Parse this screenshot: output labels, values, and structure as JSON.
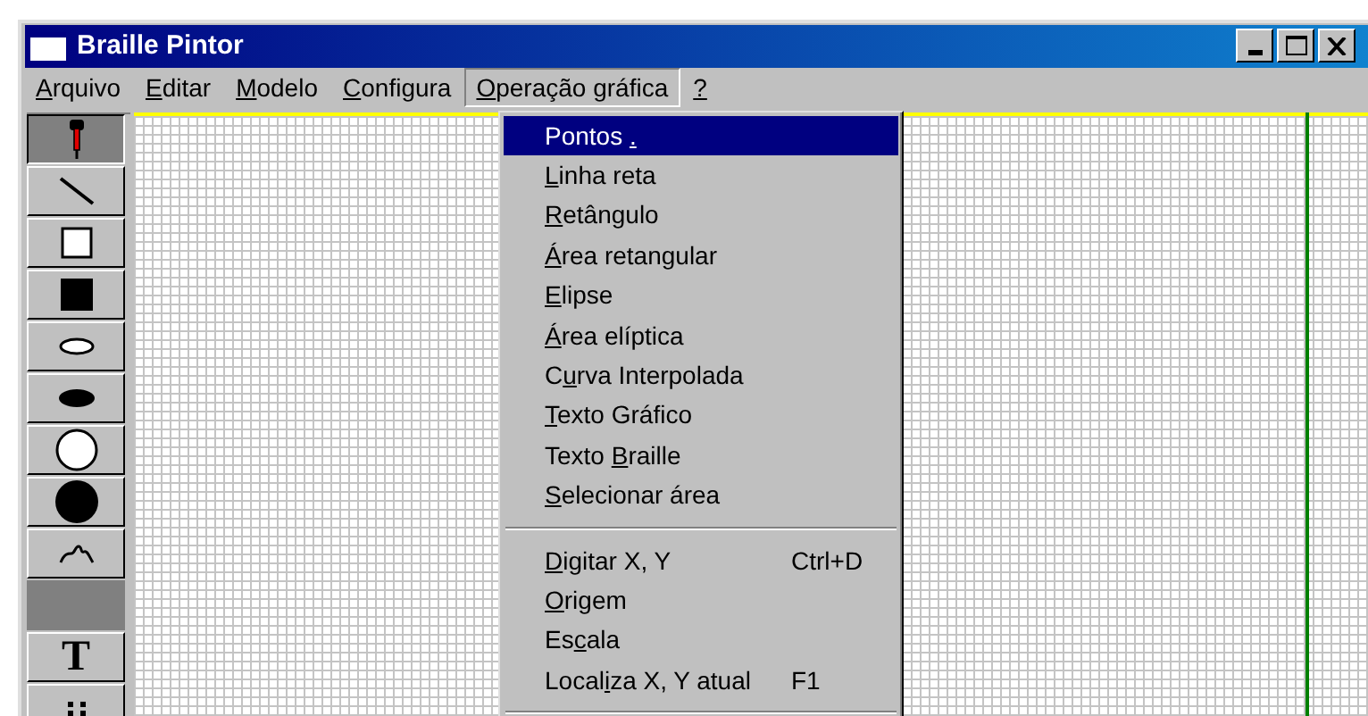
{
  "window": {
    "title": "Braille Pintor"
  },
  "menu_bar": [
    {
      "key": "A",
      "post": "rquivo",
      "selected": false
    },
    {
      "key": "E",
      "post": "ditar",
      "selected": false
    },
    {
      "key": "M",
      "post": "odelo",
      "selected": false
    },
    {
      "key": "C",
      "post": "onfigura",
      "selected": false
    },
    {
      "key": "O",
      "post": "peração gráfica",
      "selected": true
    },
    {
      "key": "?",
      "selected": false
    }
  ],
  "toolbar": [
    {
      "kind": "pin",
      "selected": true
    },
    {
      "kind": "line",
      "selected": false
    },
    {
      "kind": "rect",
      "selected": false
    },
    {
      "kind": "filled-rect",
      "selected": false
    },
    {
      "kind": "ellipse",
      "selected": false
    },
    {
      "kind": "filled-ellipse",
      "selected": false
    },
    {
      "kind": "circle",
      "selected": false
    },
    {
      "kind": "filled-circle",
      "selected": false
    },
    {
      "kind": "curve",
      "selected": false
    },
    {
      "kind": "blank",
      "selected": false
    },
    {
      "kind": "text",
      "label": "T",
      "selected": false
    },
    {
      "kind": "dots",
      "selected": false
    }
  ],
  "menu": [
    {
      "kind": "item",
      "pre": "Pontos ",
      "key": ".",
      "selected": true
    },
    {
      "kind": "item",
      "key": "L",
      "post": "inha reta",
      "selected": false
    },
    {
      "kind": "item",
      "key": "R",
      "post": "etângulo",
      "selected": false
    },
    {
      "kind": "item",
      "key": "Á",
      "post": "rea retangular",
      "selected": false
    },
    {
      "kind": "item",
      "key": "E",
      "post": "lipse",
      "selected": false
    },
    {
      "kind": "item",
      "key": "Á",
      "post": "rea elíptica",
      "selected": false
    },
    {
      "kind": "item",
      "pre": "C",
      "key": "u",
      "post": "rva Interpolada",
      "selected": false
    },
    {
      "kind": "item",
      "key": "T",
      "post": "exto Gráfico",
      "selected": false
    },
    {
      "kind": "item",
      "pre": "Texto ",
      "key": "B",
      "post": "raille",
      "selected": false
    },
    {
      "kind": "item",
      "key": "S",
      "post": "elecionar área",
      "selected": false
    },
    {
      "kind": "separator"
    },
    {
      "kind": "item",
      "key": "D",
      "post": "igitar X, Y",
      "shortcut": "Ctrl+D",
      "selected": false
    },
    {
      "kind": "item",
      "key": "O",
      "post": "rigem",
      "selected": false
    },
    {
      "kind": "item",
      "pre": "Es",
      "key": "c",
      "post": "ala",
      "selected": false
    },
    {
      "kind": "item",
      "pre": "Local",
      "key": "i",
      "post": "za X, Y atual",
      "shortcut": "F1",
      "selected": false
    },
    {
      "kind": "separator"
    }
  ]
}
